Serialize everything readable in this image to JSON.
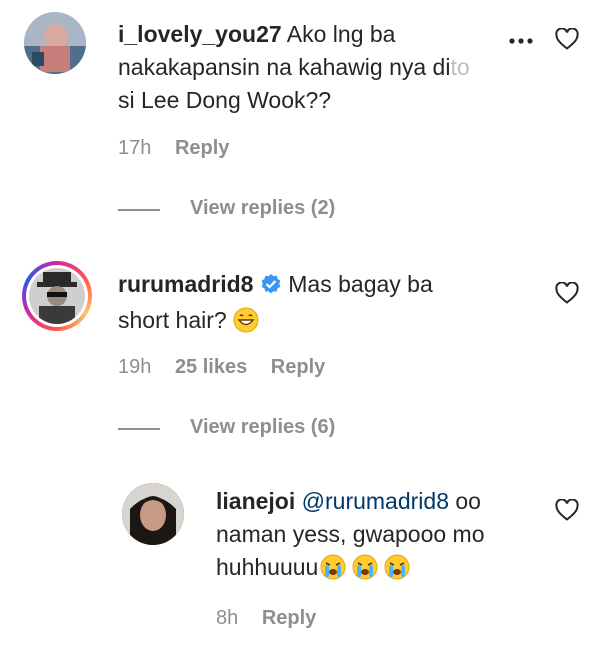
{
  "comments": [
    {
      "username": "i_lovely_you27",
      "text_line1": "Ako lng ba",
      "text_line2": "nakakapansin na kahawig nya di",
      "text_faded": "to",
      "text_line3": "si Lee Dong Wook??",
      "time": "17h",
      "reply_label": "Reply",
      "view_replies": "View replies (2)",
      "more_icon": "more-horizontal-icon"
    },
    {
      "username": "rurumadrid8",
      "verified": true,
      "text_line1": "Mas bagay ba",
      "text_line2": "short hair?",
      "time": "19h",
      "likes": "25 likes",
      "reply_label": "Reply",
      "view_replies": "View replies (6)"
    },
    {
      "username": "lianejoi",
      "mention": "@rurumadrid8",
      "text_line1": "oo",
      "text_line2": "naman yess, gwapooo mo",
      "text_line3": "huhhuuuu",
      "time": "8h",
      "reply_label": "Reply"
    }
  ],
  "colors": {
    "text": "#262626",
    "muted": "#8e8e8e",
    "verified": "#3897f0",
    "mention": "#00376b"
  }
}
